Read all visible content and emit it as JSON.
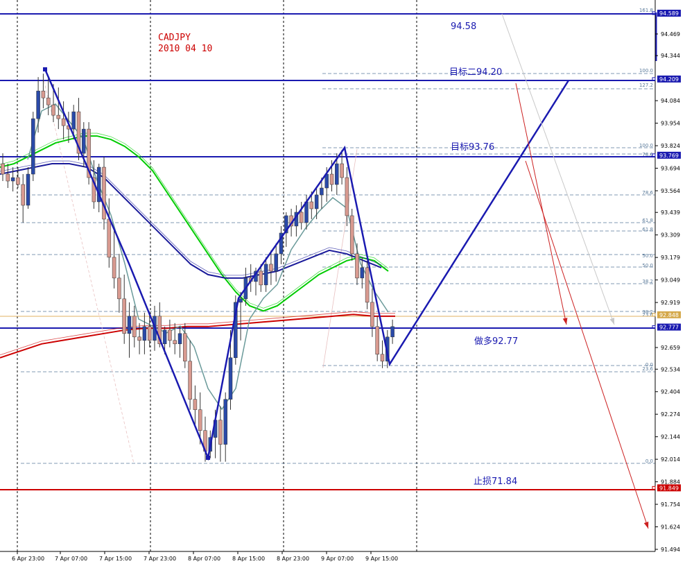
{
  "chart_data": {
    "type": "candlestick",
    "symbol": "CADJPY",
    "date": "2010 04 10",
    "ylim": [
      91.45,
      94.65
    ],
    "y_ticks": [
      "94.589",
      "94.469",
      "94.344",
      "94.209",
      "94.084",
      "93.954",
      "93.824",
      "93.769",
      "93.694",
      "93.564",
      "93.439",
      "93.309",
      "93.179",
      "93.049",
      "92.919",
      "92.848",
      "92.777",
      "92.659",
      "92.534",
      "92.404",
      "92.274",
      "92.144",
      "92.014",
      "91.884",
      "91.849",
      "91.754",
      "91.624",
      "91.494"
    ],
    "x_ticks": [
      "6 Apr 23:00",
      "7 Apr 07:00",
      "7 Apr 15:00",
      "7 Apr 23:00",
      "8 Apr 07:00",
      "8 Apr 15:00",
      "8 Apr 23:00",
      "9 Apr 07:00",
      "9 Apr 15:00"
    ],
    "candles": [
      [
        93.72,
        93.78,
        93.62,
        93.66
      ],
      [
        93.66,
        93.72,
        93.58,
        93.62
      ],
      [
        93.62,
        93.7,
        93.56,
        93.64
      ],
      [
        93.64,
        93.7,
        93.58,
        93.6
      ],
      [
        93.6,
        93.66,
        93.38,
        93.48
      ],
      [
        93.48,
        93.7,
        93.46,
        93.66
      ],
      [
        93.66,
        94.02,
        93.62,
        93.98
      ],
      [
        93.98,
        94.22,
        93.9,
        94.14
      ],
      [
        94.14,
        94.24,
        94.04,
        94.1
      ],
      [
        94.1,
        94.22,
        94.0,
        94.06
      ],
      [
        94.06,
        94.18,
        93.96,
        94.0
      ],
      [
        94.0,
        94.16,
        93.92,
        93.98
      ],
      [
        93.98,
        94.08,
        93.86,
        93.94
      ],
      [
        93.94,
        94.02,
        93.84,
        93.92
      ],
      [
        93.92,
        94.06,
        93.86,
        94.02
      ],
      [
        94.02,
        94.1,
        93.74,
        93.78
      ],
      [
        93.78,
        93.96,
        93.7,
        93.92
      ],
      [
        93.92,
        93.96,
        93.6,
        93.64
      ],
      [
        93.64,
        93.74,
        93.46,
        93.5
      ],
      [
        93.5,
        93.72,
        93.44,
        93.7
      ],
      [
        93.7,
        93.76,
        93.34,
        93.4
      ],
      [
        93.4,
        93.52,
        93.12,
        93.18
      ],
      [
        93.18,
        93.34,
        93.0,
        93.06
      ],
      [
        93.06,
        93.2,
        92.86,
        92.94
      ],
      [
        92.94,
        93.08,
        92.68,
        92.74
      ],
      [
        92.74,
        92.92,
        92.6,
        92.84
      ],
      [
        92.84,
        92.9,
        92.66,
        92.72
      ],
      [
        92.72,
        92.8,
        92.62,
        92.7
      ],
      [
        92.7,
        92.86,
        92.62,
        92.78
      ],
      [
        92.78,
        92.86,
        92.66,
        92.7
      ],
      [
        92.7,
        92.9,
        92.64,
        92.84
      ],
      [
        92.84,
        92.92,
        92.66,
        92.68
      ],
      [
        92.68,
        92.78,
        92.62,
        92.76
      ],
      [
        92.76,
        92.82,
        92.66,
        92.7
      ],
      [
        92.7,
        92.8,
        92.62,
        92.68
      ],
      [
        92.68,
        92.78,
        92.6,
        92.74
      ],
      [
        92.74,
        92.8,
        92.54,
        92.58
      ],
      [
        92.58,
        92.7,
        92.3,
        92.36
      ],
      [
        92.36,
        92.44,
        92.2,
        92.3
      ],
      [
        92.3,
        92.4,
        92.1,
        92.18
      ],
      [
        92.18,
        92.26,
        92.0,
        92.06
      ],
      [
        92.06,
        92.18,
        92.02,
        92.14
      ],
      [
        92.14,
        92.3,
        92.02,
        92.24
      ],
      [
        92.24,
        92.32,
        92.0,
        92.1
      ],
      [
        92.1,
        92.4,
        92.0,
        92.36
      ],
      [
        92.36,
        92.76,
        92.3,
        92.6
      ],
      [
        92.6,
        92.96,
        92.56,
        92.92
      ],
      [
        92.92,
        92.98,
        92.7,
        92.94
      ],
      [
        92.94,
        93.12,
        92.9,
        93.06
      ],
      [
        93.06,
        93.14,
        92.98,
        93.04
      ],
      [
        93.04,
        93.12,
        92.96,
        93.1
      ],
      [
        93.1,
        93.14,
        92.98,
        93.02
      ],
      [
        93.02,
        93.18,
        92.98,
        93.14
      ],
      [
        93.14,
        93.22,
        93.02,
        93.1
      ],
      [
        93.1,
        93.26,
        93.04,
        93.2
      ],
      [
        93.2,
        93.36,
        93.14,
        93.32
      ],
      [
        93.32,
        93.44,
        93.24,
        93.42
      ],
      [
        93.42,
        93.46,
        93.3,
        93.36
      ],
      [
        93.36,
        93.48,
        93.3,
        93.44
      ],
      [
        93.44,
        93.5,
        93.34,
        93.38
      ],
      [
        93.38,
        93.54,
        93.34,
        93.5
      ],
      [
        93.5,
        93.56,
        93.4,
        93.46
      ],
      [
        93.46,
        93.58,
        93.4,
        93.54
      ],
      [
        93.54,
        93.64,
        93.46,
        93.58
      ],
      [
        93.58,
        93.7,
        93.5,
        93.66
      ],
      [
        93.66,
        93.74,
        93.56,
        93.6
      ],
      [
        93.6,
        93.78,
        93.54,
        93.72
      ],
      [
        93.72,
        93.8,
        93.6,
        93.64
      ],
      [
        93.64,
        93.7,
        93.36,
        93.42
      ],
      [
        93.42,
        93.46,
        93.16,
        93.2
      ],
      [
        93.2,
        93.26,
        93.02,
        93.06
      ],
      [
        93.06,
        93.18,
        93.0,
        93.12
      ],
      [
        93.12,
        93.16,
        92.88,
        92.92
      ],
      [
        92.92,
        93.0,
        92.72,
        92.78
      ],
      [
        92.78,
        92.84,
        92.58,
        92.62
      ],
      [
        92.62,
        92.7,
        92.54,
        92.58
      ],
      [
        92.58,
        92.76,
        92.54,
        92.72
      ],
      [
        92.72,
        92.82,
        92.68,
        92.78
      ]
    ],
    "series": [
      {
        "name": "",
        "color": "#00cc00",
        "values": [
          93.7,
          93.72,
          93.76,
          93.8,
          93.84,
          93.86,
          93.88,
          93.88,
          93.86,
          93.82,
          93.76,
          93.68,
          93.56,
          93.44,
          93.32,
          93.2,
          93.08,
          92.98,
          92.9,
          92.87,
          92.9,
          92.96,
          93.02,
          93.08,
          93.12,
          93.16,
          93.18,
          93.16,
          93.1
        ]
      },
      {
        "name": "",
        "color": "#1a1a9a",
        "values": [
          93.66,
          93.68,
          93.7,
          93.72,
          93.72,
          93.7,
          93.64,
          93.54,
          93.44,
          93.34,
          93.24,
          93.14,
          93.08,
          93.06,
          93.06,
          93.08,
          93.1,
          93.14,
          93.18,
          93.22,
          93.2,
          93.16,
          93.12
        ]
      },
      {
        "name": "",
        "color": "#cc0000",
        "values": [
          92.6,
          92.64,
          92.68,
          92.7,
          92.72,
          92.74,
          92.76,
          92.77,
          92.77,
          92.78,
          92.78,
          92.79,
          92.8,
          92.81,
          92.82,
          92.83,
          92.84,
          92.85,
          92.84,
          92.84
        ]
      }
    ],
    "annotations": [
      {
        "text": "94.58",
        "price": 94.58
      },
      {
        "text": "目标二94.20",
        "price": 94.2
      },
      {
        "text": "目标93.76",
        "price": 93.76
      },
      {
        "text": "做多92.77",
        "price": 92.77
      },
      {
        "text": "止损71.84",
        "price": 91.84
      }
    ],
    "fib_labels": [
      "161.8",
      "100.0",
      "127.2",
      "100.0",
      "78.6",
      "78.6",
      "61.8",
      "61.8",
      "50.0",
      "50.0",
      "38.2",
      "38.2",
      "23.6",
      "0.0",
      "23.6",
      "0.0"
    ],
    "price_tags": [
      {
        "text": "94.589",
        "color": "#1a1ab0"
      },
      {
        "text": "94.209",
        "color": "#1a1ab0"
      },
      {
        "text": "93.769",
        "color": "#1a1ab0"
      },
      {
        "text": "92.848",
        "color": "#d4a84a"
      },
      {
        "text": "92.777",
        "color": "#1a1ab0"
      },
      {
        "text": "91.849",
        "color": "#cc0000"
      }
    ],
    "grid": true
  }
}
